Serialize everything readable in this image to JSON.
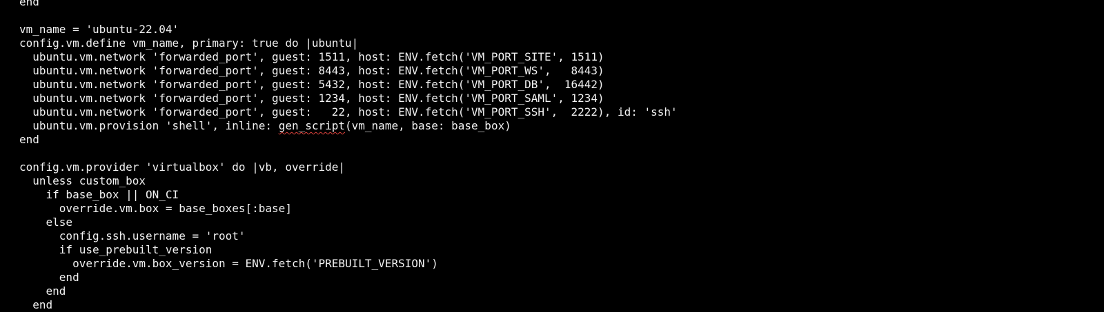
{
  "editor": {
    "lines": [
      "end",
      "",
      "vm_name = 'ubuntu-22.04'",
      "config.vm.define vm_name, primary: true do |ubuntu|",
      "  ubuntu.vm.network 'forwarded_port', guest: 1511, host: ENV.fetch('VM_PORT_SITE', 1511)",
      "  ubuntu.vm.network 'forwarded_port', guest: 8443, host: ENV.fetch('VM_PORT_WS',   8443)",
      "  ubuntu.vm.network 'forwarded_port', guest: 5432, host: ENV.fetch('VM_PORT_DB',  16442)",
      "  ubuntu.vm.network 'forwarded_port', guest: 1234, host: ENV.fetch('VM_PORT_SAML', 1234)",
      "  ubuntu.vm.network 'forwarded_port', guest:   22, host: ENV.fetch('VM_PORT_SSH',  2222), id: 'ssh'",
      {
        "before": "  ubuntu.vm.provision 'shell', inline: ",
        "flagged": "gen_script",
        "after": "(vm_name, base: base_box)"
      },
      "end",
      "",
      "config.vm.provider 'virtualbox' do |vb, override|",
      "  unless custom_box",
      "    if base_box || ON_CI",
      "      override.vm.box = base_boxes[:base]",
      "    else",
      "      config.ssh.username = 'root'",
      "      if use_prebuilt_version",
      "        override.vm.box_version = ENV.fetch('PREBUILT_VERSION')",
      "      end",
      "    end",
      "  end"
    ],
    "colors": {
      "background": "#000000",
      "text": "#f2f2f2",
      "spellcheck": "#e0443e"
    }
  }
}
